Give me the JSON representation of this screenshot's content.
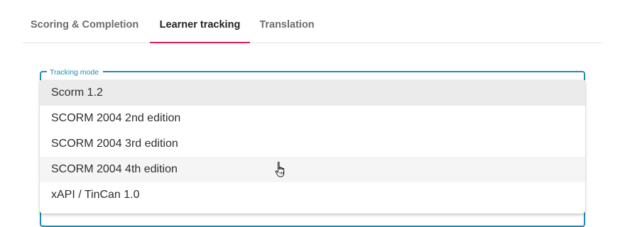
{
  "tabs": [
    {
      "label": "Scoring & Completion",
      "active": false
    },
    {
      "label": "Learner tracking",
      "active": true
    },
    {
      "label": "Translation",
      "active": false
    }
  ],
  "tracking_mode": {
    "label": "Tracking mode",
    "options": [
      {
        "label": "Scorm 1.2",
        "selected": true
      },
      {
        "label": "SCORM 2004 2nd edition",
        "selected": false
      },
      {
        "label": "SCORM 2004 3rd edition",
        "selected": false
      },
      {
        "label": "SCORM 2004 4th edition",
        "selected": false,
        "hovered": true
      },
      {
        "label": "xAPI / TinCan 1.0",
        "selected": false
      }
    ]
  },
  "colors": {
    "accent": "#d4205b",
    "focus": "#1f8bb5",
    "selected_bg": "#ebebeb",
    "hover_bg": "#f5f5f5"
  },
  "cursor": {
    "icon": "hand-pointer-icon"
  }
}
